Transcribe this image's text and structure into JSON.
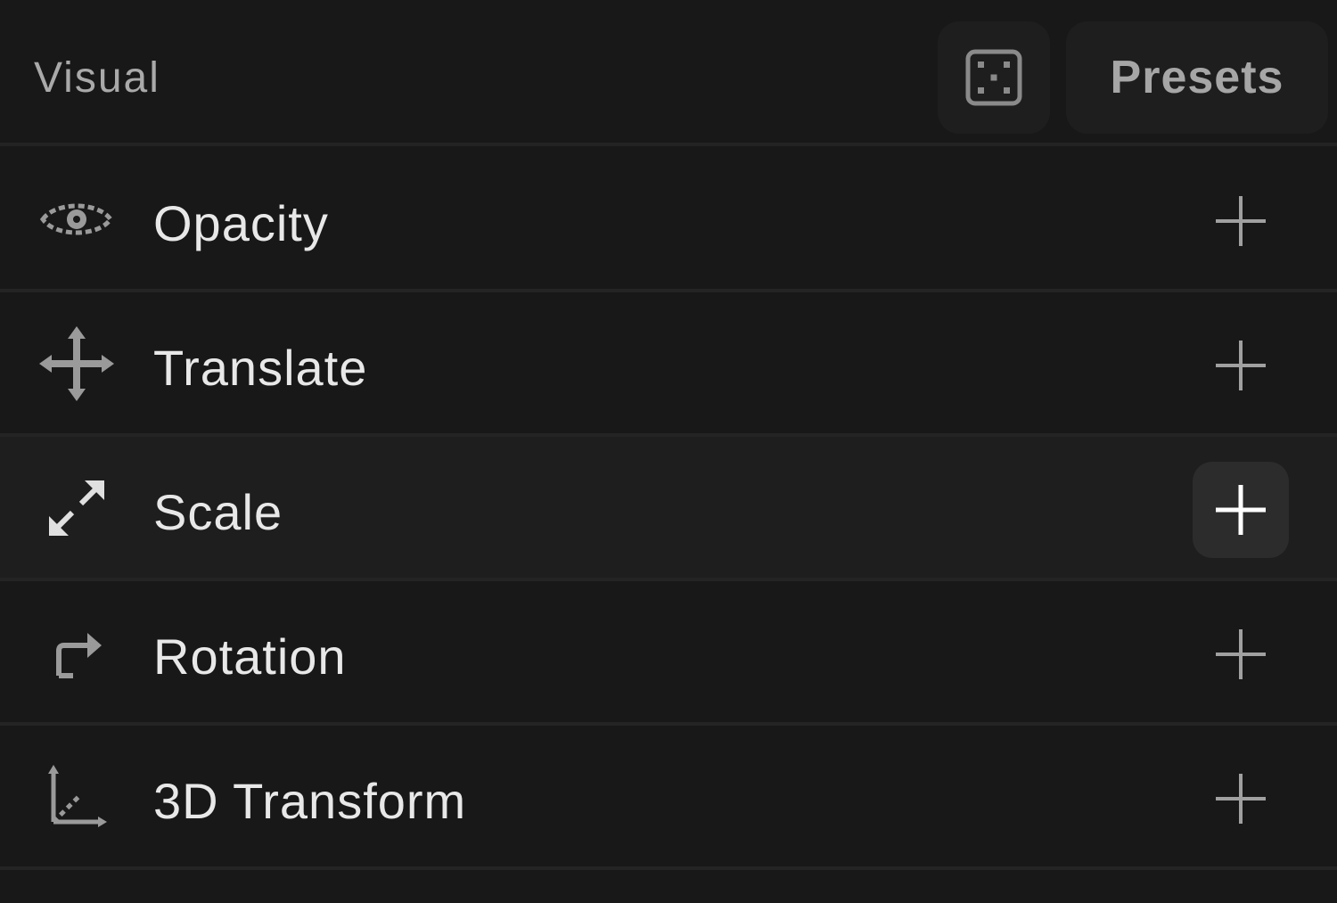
{
  "header": {
    "title": "Visual",
    "presets_label": "Presets",
    "randomize_icon": "dice-icon"
  },
  "rows": [
    {
      "label": "Opacity",
      "icon": "eye-icon"
    },
    {
      "label": "Translate",
      "icon": "move-arrows-icon"
    },
    {
      "label": "Scale",
      "icon": "expand-arrows-icon",
      "hovered": true
    },
    {
      "label": "Rotation",
      "icon": "rotate-arrow-icon"
    },
    {
      "label": "3D Transform",
      "icon": "axes-3d-icon"
    }
  ],
  "colors": {
    "background": "#181818",
    "row_hover": "#1e1e1e",
    "button_bg": "#1e1e1e",
    "divider": "#242424",
    "label_text": "#e8e8e8",
    "muted_text": "#a9a9a9"
  }
}
